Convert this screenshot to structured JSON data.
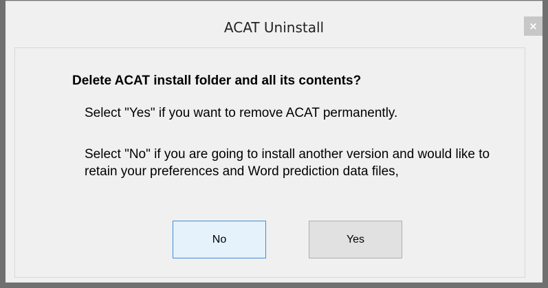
{
  "window": {
    "title": "ACAT Uninstall",
    "close_icon": "close-icon",
    "close_glyph": "×"
  },
  "dialog": {
    "heading": "Delete ACAT install folder and all its contents?",
    "yes_info": "Select \"Yes\" if you want to remove ACAT permanently.",
    "no_info": "Select \"No\" if you are going to install another version and would like to retain your preferences and Word prediction data files,"
  },
  "buttons": {
    "no_label": "No",
    "yes_label": "Yes"
  },
  "colors": {
    "default_button_border": "#3c8fd8",
    "background": "#f0f0f0",
    "frame": "#707070"
  }
}
